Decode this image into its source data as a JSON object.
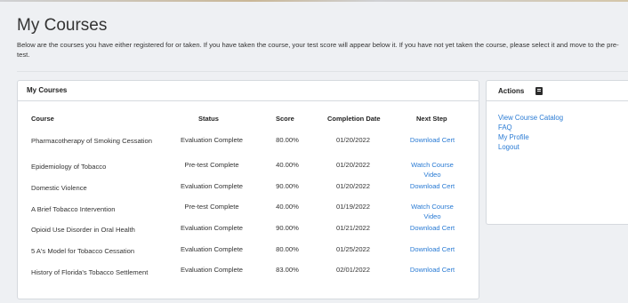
{
  "page": {
    "title": "My Courses",
    "intro": "Below are the courses you have either registered for or taken.  If you have taken the course, your test score will appear below it.  If you have not yet taken the course, please select it and move to the pre-test."
  },
  "courses_panel": {
    "title": "My Courses",
    "headers": {
      "course": "Course",
      "status": "Status",
      "score": "Score",
      "date": "Completion Date",
      "next": "Next Step"
    },
    "rows": [
      {
        "course": "Pharmacotherapy of Smoking Cessation",
        "status": "Evaluation Complete",
        "score": "80.00%",
        "date": "01/20/2022",
        "next": "Download Cert"
      },
      {
        "course": "Epidemiology of Tobacco",
        "status": "Pre-test Complete",
        "score": "40.00%",
        "date": "01/20/2022",
        "next": "Watch Course Video"
      },
      {
        "course": "Domestic Violence",
        "status": "Evaluation Complete",
        "score": "90.00%",
        "date": "01/20/2022",
        "next": "Download Cert"
      },
      {
        "course": "A Brief Tobacco Intervention",
        "status": "Pre-test Complete",
        "score": "40.00%",
        "date": "01/19/2022",
        "next": "Watch Course Video"
      },
      {
        "course": "Opioid Use Disorder in Oral Health",
        "status": "Evaluation Complete",
        "score": "90.00%",
        "date": "01/21/2022",
        "next": "Download Cert"
      },
      {
        "course": "5 A's Model for Tobacco Cessation",
        "status": "Evaluation Complete",
        "score": "80.00%",
        "date": "01/25/2022",
        "next": "Download Cert"
      },
      {
        "course": "History of Florida's Tobacco Settlement",
        "status": "Evaluation Complete",
        "score": "83.00%",
        "date": "02/01/2022",
        "next": "Download Cert"
      }
    ]
  },
  "actions_panel": {
    "title": "Actions",
    "icon": "book-icon",
    "links": [
      "View Course Catalog",
      "FAQ",
      "My Profile",
      "Logout"
    ]
  },
  "colors": {
    "link": "#2a7bd4",
    "background": "#eef0f3"
  }
}
